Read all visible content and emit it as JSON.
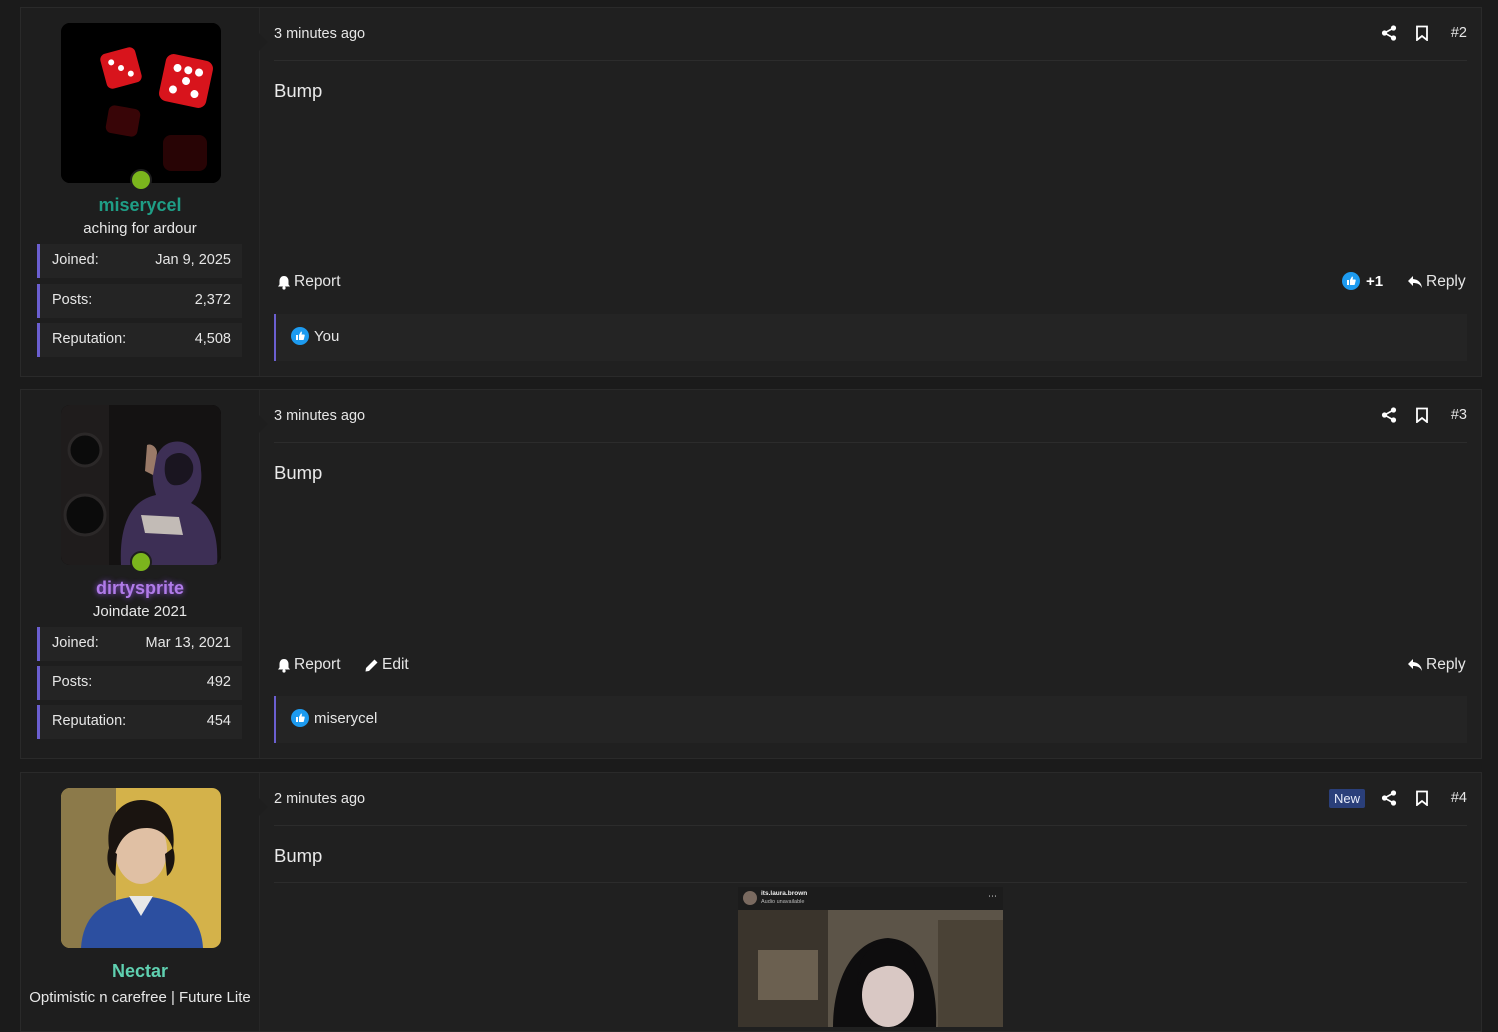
{
  "posts": [
    {
      "user": {
        "name": "miserycel",
        "name_color": "#1f9e86",
        "title": "aching for ardour"
      },
      "stats": [
        {
          "label": "Joined:",
          "value": "Jan 9, 2025"
        },
        {
          "label": "Posts:",
          "value": "2,372"
        },
        {
          "label": "Reputation:",
          "value": "4,508"
        }
      ],
      "time": "3 minutes ago",
      "number": "#2",
      "body": "Bump",
      "actions": {
        "report": "Report",
        "reply": "Reply"
      },
      "reaction_count": "+1",
      "likes_by": "You",
      "online": true
    },
    {
      "user": {
        "name": "dirtysprite",
        "name_color": "#b07be8",
        "title": "Joindate 2021"
      },
      "stats": [
        {
          "label": "Joined:",
          "value": "Mar 13, 2021"
        },
        {
          "label": "Posts:",
          "value": "492"
        },
        {
          "label": "Reputation:",
          "value": "454"
        }
      ],
      "time": "3 minutes ago",
      "number": "#3",
      "body": "Bump",
      "actions": {
        "report": "Report",
        "edit": "Edit",
        "reply": "Reply"
      },
      "likes_by": "miserycel",
      "online": true
    },
    {
      "user": {
        "name": "Nectar",
        "name_color": "#5fd0b0",
        "title": "Optimistic n carefree | Future Lite"
      },
      "time": "2 minutes ago",
      "badge": "New",
      "number": "#4",
      "body": "Bump",
      "image": {
        "account": "its.laura.brown",
        "subtitle": "Audio unavailable"
      }
    }
  ]
}
